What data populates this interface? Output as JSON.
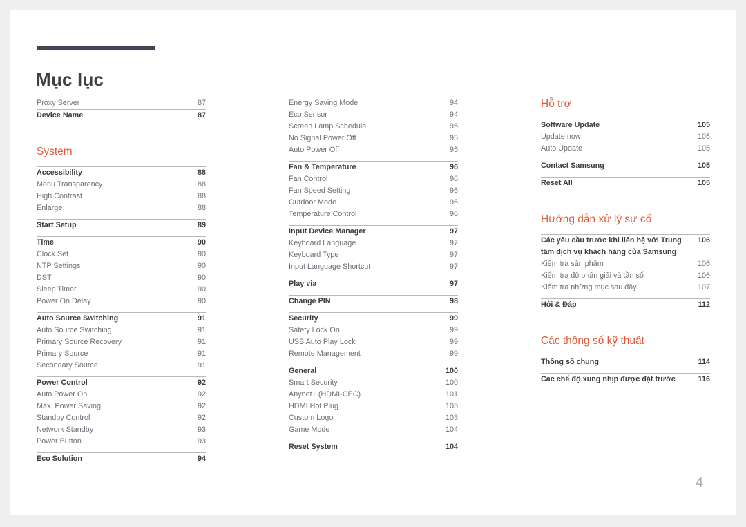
{
  "document": {
    "title": "Mục lục",
    "folio": "4",
    "accent_color": "#dd5b38",
    "rule_color": "#454354"
  },
  "columns": [
    {
      "name": "column-1",
      "blocks": [
        {
          "type": "group",
          "rule": false,
          "rows": [
            {
              "label": "Proxy Server",
              "page": "87",
              "level": 2
            }
          ]
        },
        {
          "type": "group",
          "rule": true,
          "rows": [
            {
              "label": "Device Name",
              "page": "87",
              "level": 1
            }
          ]
        },
        {
          "type": "gap",
          "size": "lg"
        },
        {
          "type": "heading",
          "label": "System"
        },
        {
          "type": "gap",
          "size": "sm"
        },
        {
          "type": "group",
          "rule": true,
          "rows": [
            {
              "label": "Accessibility",
              "page": "88",
              "level": 1
            },
            {
              "label": "Menu Transparency",
              "page": "88",
              "level": 2
            },
            {
              "label": "High Contrast",
              "page": "88",
              "level": 2
            },
            {
              "label": "Enlarge",
              "page": "88",
              "level": 2
            }
          ]
        },
        {
          "type": "gap",
          "size": "xs"
        },
        {
          "type": "group",
          "rule": true,
          "rows": [
            {
              "label": "Start Setup",
              "page": "89",
              "level": 1
            }
          ]
        },
        {
          "type": "gap",
          "size": "xs"
        },
        {
          "type": "group",
          "rule": true,
          "rows": [
            {
              "label": "Time",
              "page": "90",
              "level": 1
            },
            {
              "label": "Clock Set",
              "page": "90",
              "level": 2
            },
            {
              "label": "NTP Settings",
              "page": "90",
              "level": 2
            },
            {
              "label": "DST",
              "page": "90",
              "level": 2
            },
            {
              "label": "Sleep Timer",
              "page": "90",
              "level": 2
            },
            {
              "label": "Power On Delay",
              "page": "90",
              "level": 2
            }
          ]
        },
        {
          "type": "gap",
          "size": "xs"
        },
        {
          "type": "group",
          "rule": true,
          "rows": [
            {
              "label": "Auto Source Switching",
              "page": "91",
              "level": 1
            },
            {
              "label": "Auto Source Switching",
              "page": "91",
              "level": 2
            },
            {
              "label": "Primary Source Recovery",
              "page": "91",
              "level": 2
            },
            {
              "label": "Primary Source",
              "page": "91",
              "level": 2
            },
            {
              "label": "Secondary Source",
              "page": "91",
              "level": 2
            }
          ]
        },
        {
          "type": "gap",
          "size": "xs"
        },
        {
          "type": "group",
          "rule": true,
          "rows": [
            {
              "label": "Power Control",
              "page": "92",
              "level": 1
            },
            {
              "label": "Auto Power On",
              "page": "92",
              "level": 2
            },
            {
              "label": "Max. Power Saving",
              "page": "92",
              "level": 2
            },
            {
              "label": "Standby Control",
              "page": "92",
              "level": 2
            },
            {
              "label": "Network Standby",
              "page": "93",
              "level": 2
            },
            {
              "label": "Power Button",
              "page": "93",
              "level": 2
            }
          ]
        },
        {
          "type": "gap",
          "size": "xs"
        },
        {
          "type": "group",
          "rule": true,
          "rows": [
            {
              "label": "Eco Solution",
              "page": "94",
              "level": 1
            }
          ]
        }
      ]
    },
    {
      "name": "column-2",
      "blocks": [
        {
          "type": "group",
          "rule": false,
          "rows": [
            {
              "label": "Energy Saving Mode",
              "page": "94",
              "level": 2
            },
            {
              "label": "Eco Sensor",
              "page": "94",
              "level": 2
            },
            {
              "label": "Screen Lamp Schedule",
              "page": "95",
              "level": 2
            },
            {
              "label": "No Signal Power Off",
              "page": "95",
              "level": 2
            },
            {
              "label": "Auto Power Off",
              "page": "95",
              "level": 2
            }
          ]
        },
        {
          "type": "gap",
          "size": "xs"
        },
        {
          "type": "group",
          "rule": true,
          "rows": [
            {
              "label": "Fan & Temperature",
              "page": "96",
              "level": 1
            },
            {
              "label": "Fan Control",
              "page": "96",
              "level": 2
            },
            {
              "label": "Fan Speed Setting",
              "page": "96",
              "level": 2
            },
            {
              "label": "Outdoor Mode",
              "page": "96",
              "level": 2
            },
            {
              "label": "Temperature Control",
              "page": "96",
              "level": 2
            }
          ]
        },
        {
          "type": "gap",
          "size": "xs"
        },
        {
          "type": "group",
          "rule": true,
          "rows": [
            {
              "label": "Input Device Manager",
              "page": "97",
              "level": 1
            },
            {
              "label": "Keyboard Language",
              "page": "97",
              "level": 2
            },
            {
              "label": "Keyboard Type",
              "page": "97",
              "level": 2
            },
            {
              "label": "Input Language Shortcut",
              "page": "97",
              "level": 2
            }
          ]
        },
        {
          "type": "gap",
          "size": "xs"
        },
        {
          "type": "group",
          "rule": true,
          "rows": [
            {
              "label": "Play via",
              "page": "97",
              "level": 1
            }
          ]
        },
        {
          "type": "gap",
          "size": "xs"
        },
        {
          "type": "group",
          "rule": true,
          "rows": [
            {
              "label": "Change PIN",
              "page": "98",
              "level": 1
            }
          ]
        },
        {
          "type": "gap",
          "size": "xs"
        },
        {
          "type": "group",
          "rule": true,
          "rows": [
            {
              "label": "Security",
              "page": "99",
              "level": 1
            },
            {
              "label": "Safety Lock On",
              "page": "99",
              "level": 2
            },
            {
              "label": "USB Auto Play Lock",
              "page": "99",
              "level": 2
            },
            {
              "label": "Remote Management",
              "page": "99",
              "level": 2
            }
          ]
        },
        {
          "type": "gap",
          "size": "xs"
        },
        {
          "type": "group",
          "rule": true,
          "rows": [
            {
              "label": "General",
              "page": "100",
              "level": 1
            },
            {
              "label": "Smart Security",
              "page": "100",
              "level": 2
            },
            {
              "label": "Anynet+ (HDMI-CEC)",
              "page": "101",
              "level": 2
            },
            {
              "label": "HDMI Hot Plug",
              "page": "103",
              "level": 2
            },
            {
              "label": "Custom Logo",
              "page": "103",
              "level": 2
            },
            {
              "label": "Game Mode",
              "page": "104",
              "level": 2
            }
          ]
        },
        {
          "type": "gap",
          "size": "xs"
        },
        {
          "type": "group",
          "rule": true,
          "rows": [
            {
              "label": "Reset System",
              "page": "104",
              "level": 1
            }
          ]
        }
      ]
    },
    {
      "name": "column-3",
      "blocks": [
        {
          "type": "heading",
          "label": "Hỗ trợ"
        },
        {
          "type": "gap",
          "size": "sm"
        },
        {
          "type": "group",
          "rule": true,
          "rows": [
            {
              "label": "Software Update",
              "page": "105",
              "level": 1
            },
            {
              "label": "Update now",
              "page": "105",
              "level": 2
            },
            {
              "label": "Auto Update",
              "page": "105",
              "level": 2
            }
          ]
        },
        {
          "type": "gap",
          "size": "xs"
        },
        {
          "type": "group",
          "rule": true,
          "rows": [
            {
              "label": "Contact Samsung",
              "page": "105",
              "level": 1
            }
          ]
        },
        {
          "type": "gap",
          "size": "xs"
        },
        {
          "type": "group",
          "rule": true,
          "rows": [
            {
              "label": "Reset All",
              "page": "105",
              "level": 1
            }
          ]
        },
        {
          "type": "gap",
          "size": "lg"
        },
        {
          "type": "heading",
          "label": "Hướng dẫn xử lý sự cố"
        },
        {
          "type": "gap",
          "size": "sm"
        },
        {
          "type": "group",
          "rule": true,
          "rows": [
            {
              "label": "Các yêu cầu trước khi liên hệ với Trung tâm dịch vụ khách hàng của Samsung",
              "page": "106",
              "level": 1,
              "wrap": true
            },
            {
              "label": "Kiểm tra sản phẩm",
              "page": "106",
              "level": 2
            },
            {
              "label": "Kiểm tra độ phân giải và tần số",
              "page": "106",
              "level": 2
            },
            {
              "label": "Kiểm tra những mục sau đây.",
              "page": "107",
              "level": 2
            }
          ]
        },
        {
          "type": "gap",
          "size": "xs"
        },
        {
          "type": "group",
          "rule": true,
          "rows": [
            {
              "label": "Hỏi & Đáp",
              "page": "112",
              "level": 1
            }
          ]
        },
        {
          "type": "gap",
          "size": "lg"
        },
        {
          "type": "heading",
          "label": "Các thông số kỹ thuật"
        },
        {
          "type": "gap",
          "size": "sm"
        },
        {
          "type": "group",
          "rule": true,
          "rows": [
            {
              "label": "Thông số chung",
              "page": "114",
              "level": 1
            }
          ]
        },
        {
          "type": "gap",
          "size": "xs"
        },
        {
          "type": "group",
          "rule": true,
          "rows": [
            {
              "label": "Các chế độ xung nhịp được đặt trước",
              "page": "116",
              "level": 1
            }
          ]
        }
      ]
    }
  ]
}
